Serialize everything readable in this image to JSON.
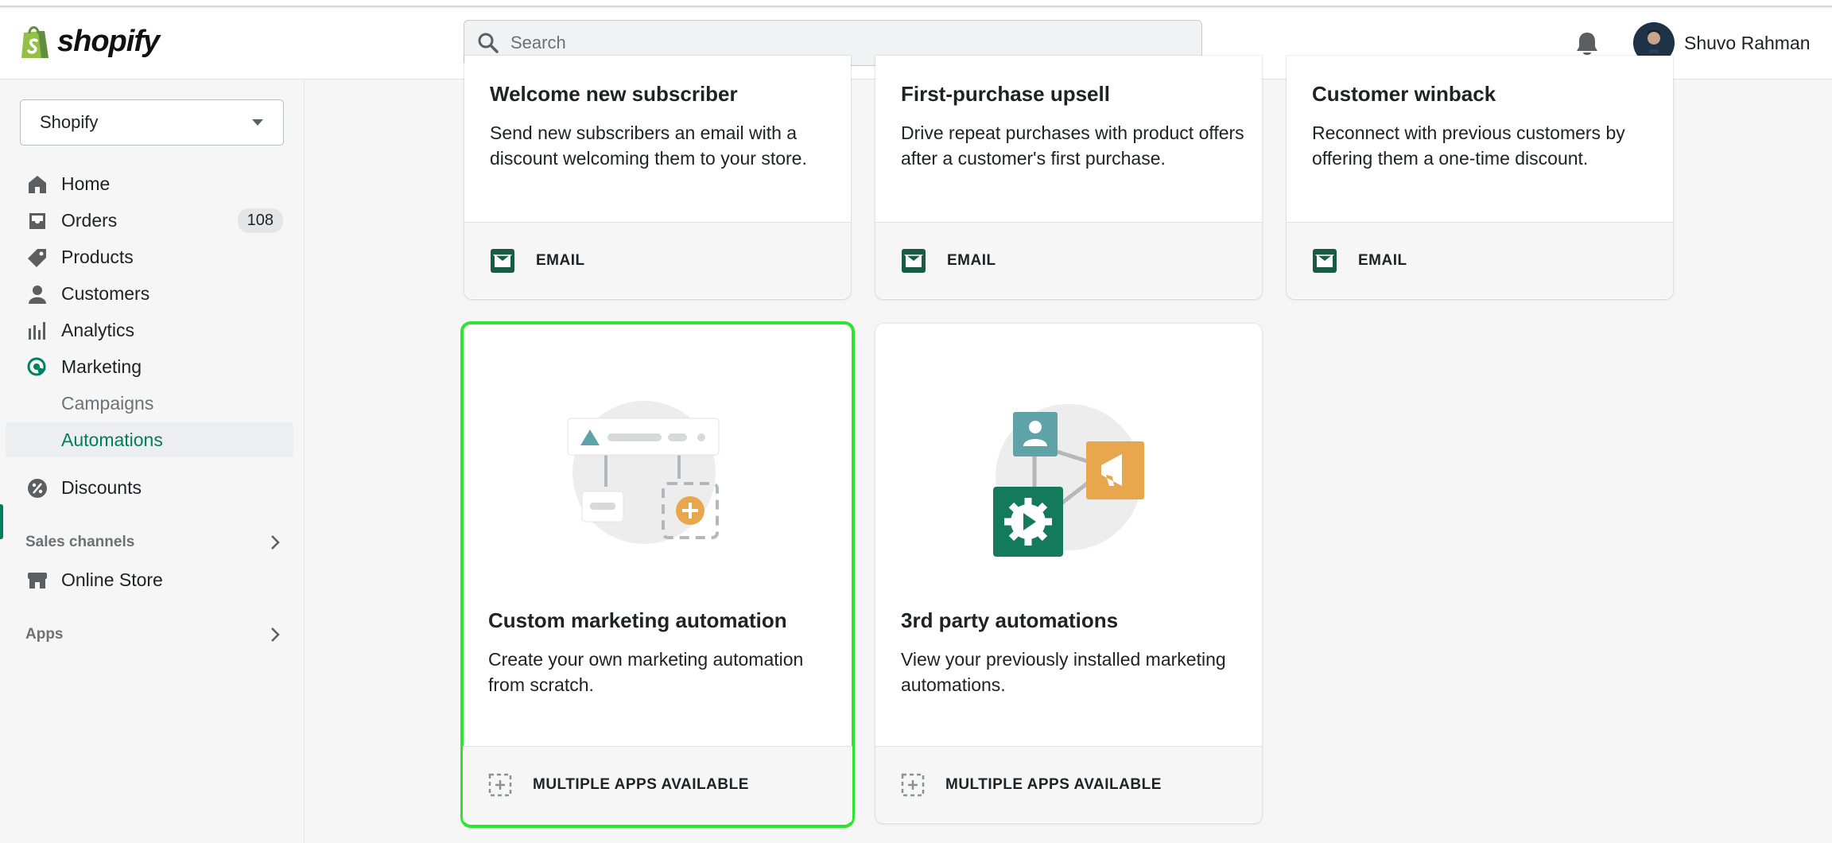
{
  "topbar": {
    "logo_text": "shopify",
    "search_placeholder": "Search",
    "user_name": "Shuvo Rahman"
  },
  "sidebar": {
    "store_name": "Shopify",
    "items": [
      {
        "label": "Home",
        "icon": "home-icon"
      },
      {
        "label": "Orders",
        "icon": "orders-icon",
        "badge": "108"
      },
      {
        "label": "Products",
        "icon": "tag-icon"
      },
      {
        "label": "Customers",
        "icon": "person-icon"
      },
      {
        "label": "Analytics",
        "icon": "bar-chart-icon"
      },
      {
        "label": "Marketing",
        "icon": "marketing-icon"
      },
      {
        "label": "Campaigns"
      },
      {
        "label": "Automations"
      },
      {
        "label": "Discounts",
        "icon": "discount-icon"
      }
    ],
    "sales_channels_label": "Sales channels",
    "online_store_label": "Online Store",
    "apps_label": "Apps"
  },
  "cards": [
    {
      "title": "Welcome new subscriber",
      "desc": "Send new subscribers an email with a discount welcoming them to your store.",
      "footer": "EMAIL"
    },
    {
      "title": "First-purchase upsell",
      "desc": "Drive repeat purchases with product offers after a customer's first purchase.",
      "footer": "EMAIL"
    },
    {
      "title": "Customer winback",
      "desc": "Reconnect with previous customers by offering them a one-time discount.",
      "footer": "EMAIL"
    },
    {
      "title": "Custom marketing automation",
      "desc": "Create your own marketing automation from scratch.",
      "footer": "MULTIPLE APPS AVAILABLE"
    },
    {
      "title": "3rd party automations",
      "desc": "View your previously installed marketing automations.",
      "footer": "MULTIPLE APPS AVAILABLE"
    }
  ],
  "colors": {
    "accent": "#008060",
    "selection": "#2ee52e",
    "email_icon": "#1a5b45",
    "illustration_orange": "#e8a74c",
    "illustration_teal": "#5fa3a8",
    "illustration_green": "#137b5c"
  }
}
